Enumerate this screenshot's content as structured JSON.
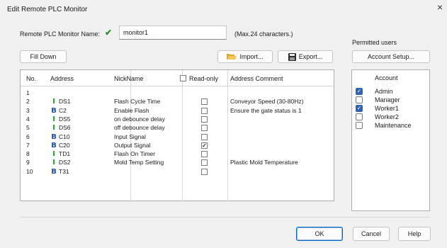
{
  "dialog": {
    "title": "Edit Remote PLC Monitor",
    "close_glyph": "×"
  },
  "name_row": {
    "label": "Remote PLC Monitor Name:",
    "status_icon": "check-icon",
    "value": "monitor1",
    "hint": "(Max.24 characters.)"
  },
  "toolbar": {
    "fill_down": "Fill Down",
    "import": "Import...",
    "export": "Export..."
  },
  "table": {
    "headers": {
      "no": "No.",
      "address": "Address",
      "nickname": "NickName",
      "readonly": "Read-only",
      "comment": "Address Comment"
    },
    "rows": [
      {
        "no": "1",
        "type": "",
        "address": "",
        "nickname": "",
        "readonly": null,
        "comment": ""
      },
      {
        "no": "2",
        "type": "I",
        "address": "DS1",
        "nickname": "Flash Cycle Time",
        "readonly": false,
        "comment": "Conveyor Speed (30-80Hz)"
      },
      {
        "no": "3",
        "type": "B",
        "address": "C2",
        "nickname": "Enable Flash",
        "readonly": false,
        "comment": "Ensure the gate status is 1"
      },
      {
        "no": "4",
        "type": "I",
        "address": "DS5",
        "nickname": "on debounce delay",
        "readonly": false,
        "comment": ""
      },
      {
        "no": "5",
        "type": "I",
        "address": "DS6",
        "nickname": "off debounce delay",
        "readonly": false,
        "comment": ""
      },
      {
        "no": "6",
        "type": "B",
        "address": "C10",
        "nickname": "Input Signal",
        "readonly": false,
        "comment": ""
      },
      {
        "no": "7",
        "type": "B",
        "address": "C20",
        "nickname": "Output Signal",
        "readonly": true,
        "comment": ""
      },
      {
        "no": "8",
        "type": "I",
        "address": "TD1",
        "nickname": "Flash On Timer",
        "readonly": false,
        "comment": ""
      },
      {
        "no": "9",
        "type": "I",
        "address": "DS2",
        "nickname": "Mold Temp Setting",
        "readonly": false,
        "comment": "Plastic Mold Temperature"
      },
      {
        "no": "10",
        "type": "B",
        "address": "T31",
        "nickname": "",
        "readonly": false,
        "comment": ""
      }
    ]
  },
  "users": {
    "title": "Permitted users",
    "setup_button": "Account Setup...",
    "header": "Account",
    "items": [
      {
        "name": "Admin",
        "checked": true
      },
      {
        "name": "Manager",
        "checked": false
      },
      {
        "name": "Worker1",
        "checked": true
      },
      {
        "name": "Worker2",
        "checked": false
      },
      {
        "name": "Maintenance",
        "checked": false
      }
    ]
  },
  "footer": {
    "ok": "OK",
    "cancel": "Cancel",
    "help": "Help"
  },
  "colors": {
    "type_i": "#2a9a2a",
    "type_b": "#1f4fa0",
    "checked_user": "#2d64b3",
    "default_button_border": "#0067c0"
  }
}
